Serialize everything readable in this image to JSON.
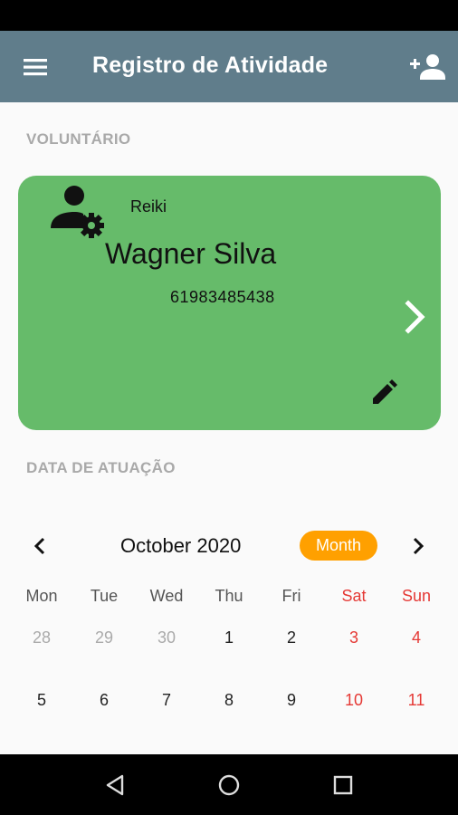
{
  "app_bar": {
    "title": "Registro de Atividade",
    "menu_icon": "menu-icon",
    "action_icon": "person-add-icon"
  },
  "volunteer_section": {
    "label": "VOLUNTÁRIO",
    "card": {
      "icon": "user-settings-icon",
      "activity": "Reiki",
      "name": "Wagner Silva",
      "phone": "61983485438",
      "open_icon": "chevron-right-icon",
      "edit_icon": "edit-icon"
    }
  },
  "date_section": {
    "label": "DATA DE ATUAÇÃO"
  },
  "calendar": {
    "month_title": "October 2020",
    "format_button": "Month",
    "weekdays": [
      "Mon",
      "Tue",
      "Wed",
      "Thu",
      "Fri",
      "Sat",
      "Sun"
    ],
    "weeks": [
      [
        {
          "day": "28",
          "outside": true
        },
        {
          "day": "29",
          "outside": true
        },
        {
          "day": "30",
          "outside": true
        },
        {
          "day": "1",
          "outside": false
        },
        {
          "day": "2",
          "outside": false
        },
        {
          "day": "3",
          "outside": false
        },
        {
          "day": "4",
          "outside": false
        }
      ],
      [
        {
          "day": "5",
          "outside": false
        },
        {
          "day": "6",
          "outside": false
        },
        {
          "day": "7",
          "outside": false
        },
        {
          "day": "8",
          "outside": false
        },
        {
          "day": "9",
          "outside": false
        },
        {
          "day": "10",
          "outside": false
        },
        {
          "day": "11",
          "outside": false
        }
      ]
    ]
  },
  "colors": {
    "app_bar": "#607d8b",
    "card": "#66bb6a",
    "accent": "#ffa000",
    "weekend": "#e53935"
  }
}
